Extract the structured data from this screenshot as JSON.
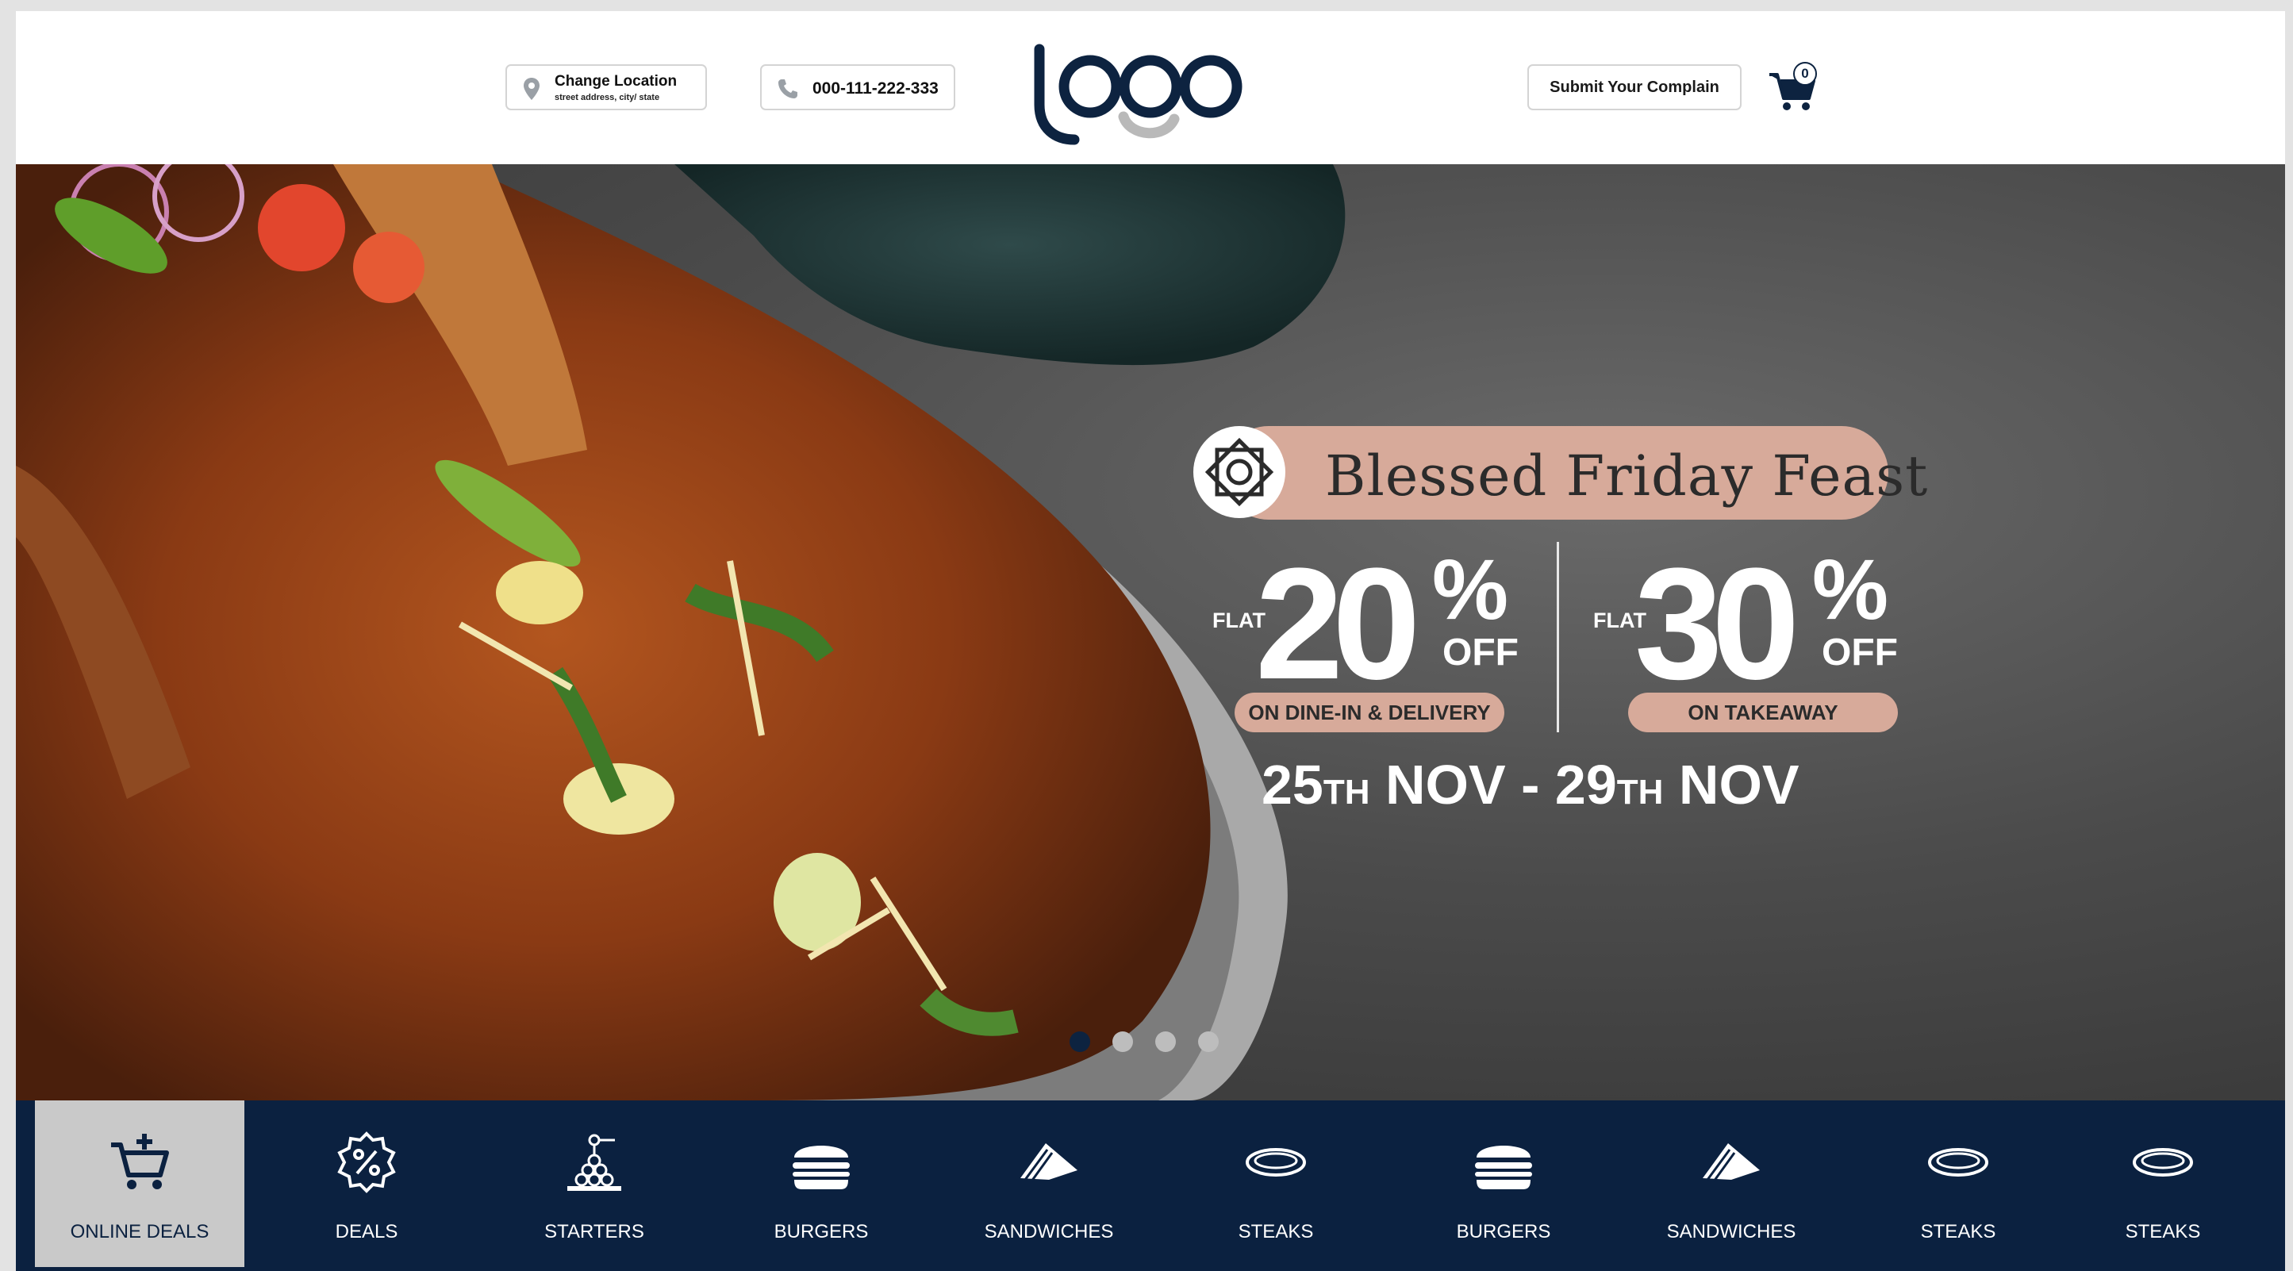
{
  "header": {
    "location": {
      "title": "Change Location",
      "subtitle": "street address, city/ state",
      "icon": "location-pin-icon"
    },
    "phone": {
      "number": "000-111-222-333",
      "icon": "phone-icon"
    },
    "logo_text": "logo",
    "complain_label": "Submit Your Complain",
    "cart": {
      "icon": "cart-icon",
      "count": "0"
    }
  },
  "hero": {
    "banner_title": "Blessed Friday Feast",
    "offers": [
      {
        "flat": "FLAT",
        "value": "20",
        "percent": "%",
        "off": "OFF",
        "label": "ON DINE-IN & DELIVERY"
      },
      {
        "flat": "FLAT",
        "value": "30",
        "percent": "%",
        "off": "OFF",
        "label": "ON TAKEAWAY"
      }
    ],
    "dates": {
      "d1": "25",
      "s1": "TH",
      "m1": "NOV",
      "sep": "-",
      "d2": "29",
      "s2": "TH",
      "m2": "NOV"
    },
    "carousel": {
      "count": 4,
      "active": 1
    }
  },
  "categories": [
    {
      "label": "ONLINE DEALS",
      "icon": "cart-plus-icon",
      "active": true
    },
    {
      "label": "DEALS",
      "icon": "discount-badge-icon"
    },
    {
      "label": "STARTERS",
      "icon": "starters-icon"
    },
    {
      "label": "BURGERS",
      "icon": "burger-icon"
    },
    {
      "label": "SANDWICHES",
      "icon": "sandwich-icon"
    },
    {
      "label": "STEAKS",
      "icon": "steak-icon"
    },
    {
      "label": "BURGERS",
      "icon": "burger-icon"
    },
    {
      "label": "SANDWICHES",
      "icon": "sandwich-icon"
    },
    {
      "label": "STEAKS",
      "icon": "steak-icon"
    },
    {
      "label": "STEAKS",
      "icon": "steak-icon"
    }
  ],
  "colors": {
    "navy": "#0b2140",
    "peach": "#d7aa9a",
    "active_tab": "#c9c9c9"
  }
}
